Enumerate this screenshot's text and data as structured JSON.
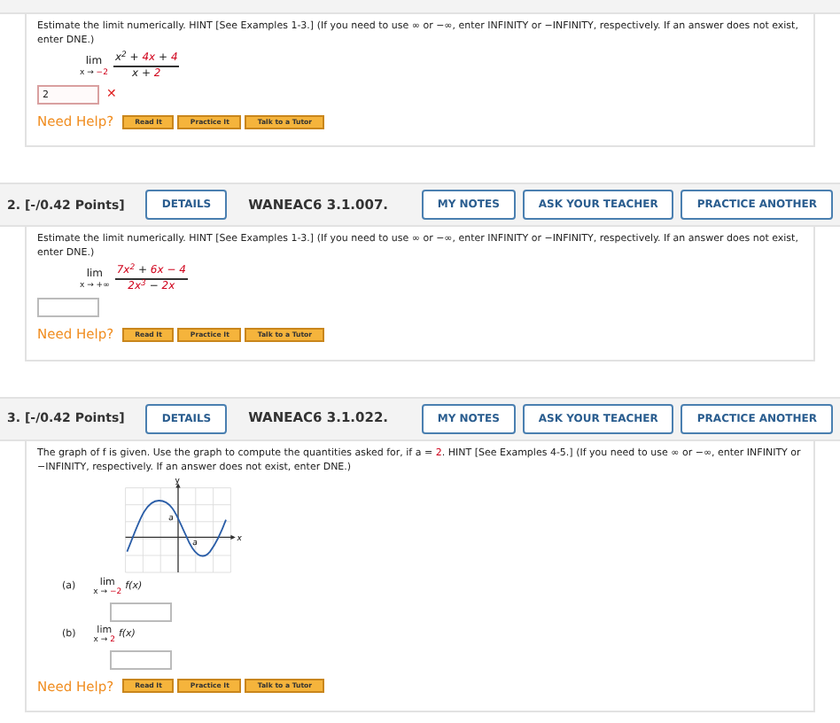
{
  "questions": [
    {
      "prompt": [
        {
          "text": "Estimate the limit numerically. HINT [See Examples 1-3.] (If you need to use ∞ or −∞, enter INFINITY or −INFINITY, respectively. If an answer does not exist, enter DNE.)",
          "highlighted": false
        }
      ],
      "kind": "limit",
      "limit": {
        "label": "lim",
        "sub": [
          {
            "text": "x → ",
            "highlighted": false
          },
          {
            "text": "−2",
            "highlighted": true
          }
        ],
        "numerator": [
          {
            "text": "x$^{2}$ + ",
            "highlighted": false
          },
          {
            "text": "4x",
            "highlighted": true
          },
          {
            "text": " + ",
            "highlighted": false
          },
          {
            "text": "4",
            "highlighted": true
          }
        ],
        "denominator": [
          {
            "text": "x + ",
            "highlighted": false
          },
          {
            "text": "2",
            "highlighted": true
          }
        ]
      },
      "answers": [
        {
          "value": "2",
          "wrong": true,
          "mark": "✕"
        }
      ],
      "help": {
        "label": "Need Help?",
        "buttons": [
          "Read It",
          "Practice It",
          "Talk to a Tutor"
        ]
      }
    },
    {
      "header": {
        "number": "2.",
        "points": "[-/0.42 Points]",
        "details": "DETAILS",
        "code": "WANEAC6 3.1.007.",
        "buttons": [
          "MY NOTES",
          "ASK YOUR TEACHER",
          "PRACTICE ANOTHER"
        ]
      },
      "prompt": [
        {
          "text": "Estimate the limit numerically. HINT [See Examples 1-3.] (If you need to use ∞ or −∞, enter INFINITY or −INFINITY, respectively. If an answer does not exist, enter DNE.)",
          "highlighted": false
        }
      ],
      "kind": "limit",
      "limit": {
        "label": "lim",
        "sub": [
          {
            "text": "x → +∞",
            "highlighted": false
          }
        ],
        "numerator": [
          {
            "text": "7x$^{2}$",
            "highlighted": true
          },
          {
            "text": " + ",
            "highlighted": false
          },
          {
            "text": "6x − 4",
            "highlighted": true
          }
        ],
        "denominator": [
          {
            "text": "2x$^{3}$",
            "highlighted": true
          },
          {
            "text": " − ",
            "highlighted": false
          },
          {
            "text": "2x",
            "highlighted": true
          }
        ]
      },
      "answers": [
        {
          "wrong": false
        }
      ],
      "help": {
        "label": "Need Help?",
        "buttons": [
          "Read It",
          "Practice It",
          "Talk to a Tutor"
        ]
      }
    },
    {
      "header": {
        "number": "3.",
        "points": "[-/0.42 Points]",
        "details": "DETAILS",
        "code": "WANEAC6 3.1.022.",
        "buttons": [
          "MY NOTES",
          "ASK YOUR TEACHER",
          "PRACTICE ANOTHER"
        ]
      },
      "prompt": [
        {
          "text": "The graph of f is given. Use the graph to compute the quantities asked for, if a = ",
          "highlighted": false
        },
        {
          "text": "2",
          "highlighted": true
        },
        {
          "text": ". HINT [See Examples 4-5.] (If you need to use ∞ or −∞, enter INFINITY or −INFINITY, respectively. If an answer does not exist, enter DNE.)",
          "highlighted": false
        }
      ],
      "kind": "graph",
      "graph": {
        "y_label": "y",
        "x_label": "x",
        "point_labels": [
          "a",
          "a"
        ]
      },
      "parts": [
        {
          "label": "(a)",
          "lim": "lim",
          "sub": [
            {
              "text": "x → ",
              "highlighted": false
            },
            {
              "text": "−2",
              "highlighted": true
            }
          ],
          "expr": "f(x)"
        },
        {
          "label": "(b)",
          "lim": "lim",
          "sub": [
            {
              "text": "x → ",
              "highlighted": false
            },
            {
              "text": "2",
              "highlighted": true
            }
          ],
          "expr": "f(x)"
        }
      ],
      "help": {
        "label": "Need Help?",
        "buttons": [
          "Read It",
          "Practice It",
          "Talk to a Tutor"
        ]
      }
    }
  ]
}
